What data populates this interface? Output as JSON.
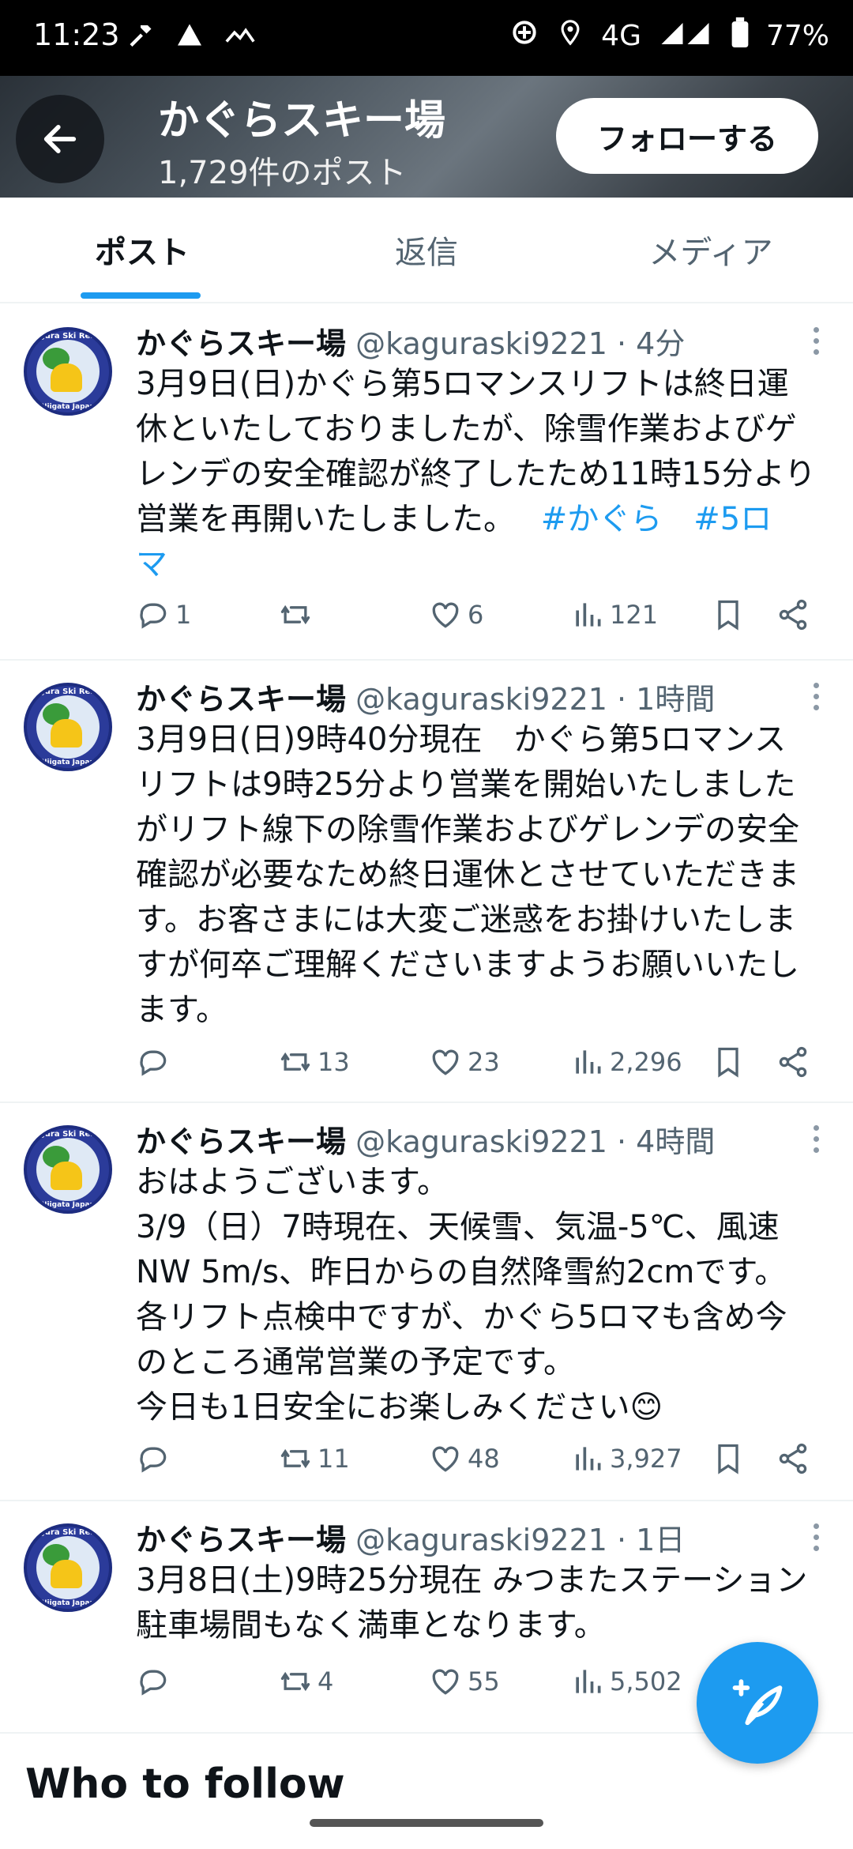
{
  "status_bar": {
    "time": "11:23",
    "network": "4G",
    "battery": "77%",
    "icons": [
      "hammer-icon",
      "warning-icon",
      "signal-icon",
      "target-icon",
      "location-icon",
      "cell-signal-icon",
      "battery-icon"
    ]
  },
  "header": {
    "title": "かぐらスキー場",
    "post_count": "1,729件のポスト",
    "follow_label": "フォローする"
  },
  "tabs": [
    {
      "label": "ポスト",
      "active": true
    },
    {
      "label": "返信",
      "active": false
    },
    {
      "label": "メディア",
      "active": false
    }
  ],
  "posts": [
    {
      "name": "かぐらスキー場",
      "handle": "@kaguraski9221",
      "time": "4分",
      "text": "3月9日(日)かぐら第5ロマンスリフトは終日運\n休といたしておりましたが、除雪作業およびゲ\nレンデの安全確認が終了したため11時15分より\n営業を再開いたしました。",
      "tag1": "#かぐら",
      "tag2": "#5ロ",
      "tag3": "マ",
      "replies": "1",
      "reposts": "",
      "likes": "6",
      "views": "121"
    },
    {
      "name": "かぐらスキー場",
      "handle": "@kaguraski9221",
      "time": "1時間",
      "text": "3月9日(日)9時40分現在　かぐら第5ロマンス\nリフトは9時25分より営業を開始いたしました\nがリフト線下の除雪作業およびゲレンデの安全\n確認が必要なため終日運休とさせていただきま\nす。お客さまには大変ご迷惑をお掛けいたしま\nすが何卒ご理解くださいますようお願いいたし\nます。",
      "replies": "",
      "reposts": "13",
      "likes": "23",
      "views": "2,296"
    },
    {
      "name": "かぐらスキー場",
      "handle": "@kaguraski9221",
      "time": "4時間",
      "text": "おはようございます。\n3/9（日）7時現在、天候雪、気温-5℃、風速\nNW 5m/s、昨日からの自然降雪約2cmです。\n各リフト点検中ですが、かぐら5ロマも含め今\nのところ通常営業の予定です。\n今日も1日安全にお楽しみください😊",
      "replies": "",
      "reposts": "11",
      "likes": "48",
      "views": "3,927"
    },
    {
      "name": "かぐらスキー場",
      "handle": "@kaguraski9221",
      "time": "1日",
      "text": "3月8日(土)9時25分現在 みつまたステーション\n駐車場間もなく満車となります。",
      "replies": "",
      "reposts": "4",
      "likes": "55",
      "views": "5,502"
    }
  ],
  "avatar_text": {
    "top": "Kagura Ski Resort",
    "bottom": "Niigata Japan"
  },
  "who_to_follow": "Who to follow",
  "colors": {
    "accent": "#1d9bf0",
    "muted": "#536471",
    "text": "#0f1419"
  }
}
